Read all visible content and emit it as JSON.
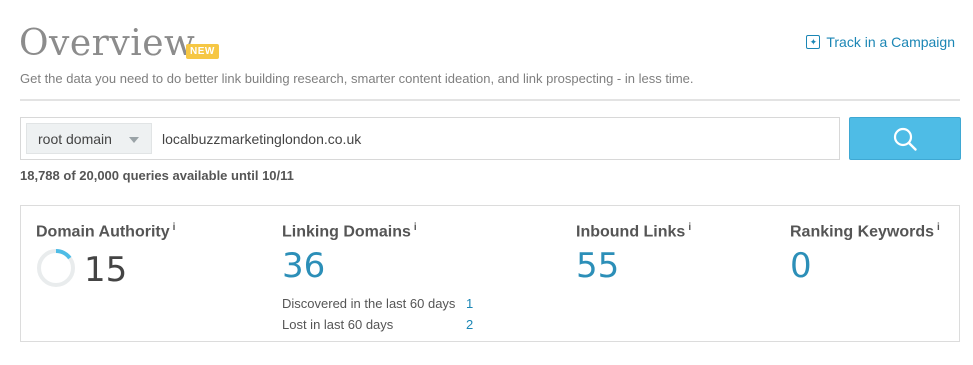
{
  "header": {
    "title": "Overview",
    "badge": "NEW",
    "track_link": "Track in a Campaign",
    "subtitle": "Get the data you need to do better link building research, smarter content ideation, and link prospecting - in less time."
  },
  "search": {
    "scope_selected": "root domain",
    "domain_value": "localbuzzmarketinglondon.co.uk",
    "queries_text": "18,788 of 20,000 queries available until 10/11"
  },
  "metrics": {
    "domain_authority": {
      "label": "Domain Authority",
      "info": "i",
      "value": "15",
      "gauge_fraction": 0.15
    },
    "linking_domains": {
      "label": "Linking Domains",
      "info": "i",
      "value": "36",
      "discovered_label": "Discovered in the last 60 days",
      "discovered_value": "1",
      "lost_label": "Lost in last 60 days",
      "lost_value": "2"
    },
    "inbound_links": {
      "label": "Inbound Links",
      "info": "i",
      "value": "55"
    },
    "ranking_keywords": {
      "label": "Ranking Keywords",
      "info": "i",
      "value": "0"
    }
  },
  "colors": {
    "accent": "#1b86b5",
    "search_button": "#4ebce6",
    "badge": "#f6c744",
    "gauge": "#4ebce6"
  },
  "icons": {
    "track": "plus-square-icon",
    "search": "magnifier-icon",
    "dropdown": "caret-down-icon"
  }
}
